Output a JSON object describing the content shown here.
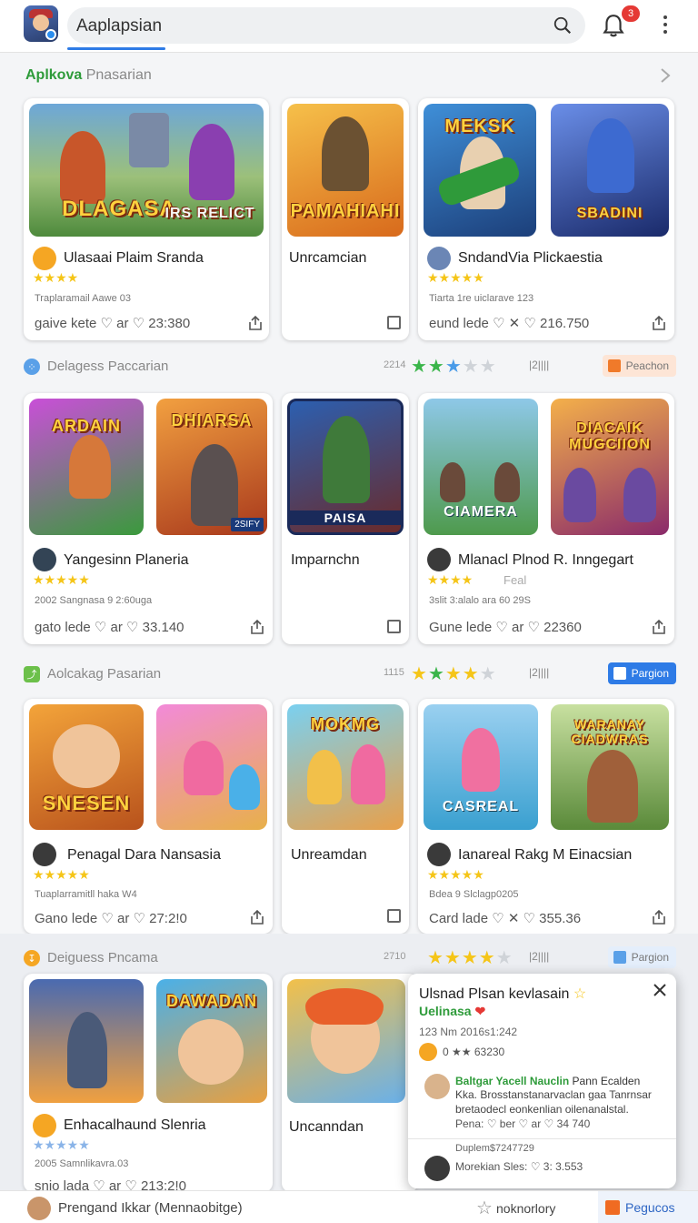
{
  "header": {
    "search_value": "Aaplapsian",
    "notification_count": "3"
  },
  "sections": [
    {
      "title_green": "Aplkova",
      "title_gray": "Pnasarian",
      "cards": [
        {
          "thumb_title": "DLAGASA",
          "thumb_sub": "IRS RELICT",
          "title": "Ulasaai Plaim Sranda",
          "sub": "Traplaramail Aawe 03",
          "footer": "gaive kete  ♡ ar ♡ 23:380",
          "rating": "★★★★"
        },
        {
          "thumb_title": "PAMAHIAHI",
          "title": "Unrcamcian"
        },
        {
          "thumb_title": "MEKSK",
          "title": "SndandVia Plickaestia",
          "sub": "Tiarta 1re uiclarave 123",
          "footer": "eund lede  ♡ ✕ ♡ 216.750",
          "rating": "★★★★★"
        },
        {
          "thumb_title": "SBADINI"
        }
      ]
    },
    {
      "title": "Delagess Paccarian",
      "meta": "2214",
      "bars": "|2||||",
      "button": "Peachon",
      "cards": [
        {
          "thumb_title": "ARDAIN",
          "thumb_title2": "DHIARSA",
          "tag": "2SIFY",
          "title": "Yangesinn Planeria",
          "sub": "2002 Sangnasa 9 2:60uga",
          "footer": "gato lede  ♡ ar ♡ 33.140",
          "rating": "★★★★★"
        },
        {
          "thumb_title": "PAISA",
          "title": "Imparnchn"
        },
        {
          "thumb_title": "CIAMERA",
          "thumb_title2": "DIACAIK MUGCIION",
          "title": "Mlanacl Plnod R. Inngegart",
          "sub": "3slit 3:alalo ara 60 29S",
          "rating_note": "Feal",
          "footer": "Gune lede  ♡ ar ♡ 22360",
          "rating": "★★★★"
        }
      ]
    },
    {
      "title": "Aolcakag Pasarian",
      "meta": "1115",
      "bars": "|2||||",
      "button": "Pargion",
      "cards": [
        {
          "thumb_title": "SNESEN",
          "title": "Penagal Dara Nansasia",
          "sub": "Tuaplarramitll haka W4",
          "footer": "Gano lede  ♡ ar ♡ 27:2!0",
          "rating": "★★★★★"
        },
        {
          "thumb_title": "MOKMG",
          "title": "Unreamdan"
        },
        {
          "thumb_title": "CASREAL",
          "thumb_title2": "WARANAY CIADWRAS",
          "title": "Ianareal Rakg M Einacsian",
          "sub": "Bdea 9 Slclagp0205",
          "footer": "Card lade  ♡ ✕ ♡ 355.36",
          "rating": "★★★★★"
        }
      ]
    },
    {
      "title": "Deiguess Pncama",
      "meta": "2710",
      "bars": "|2||||",
      "button": "Pargion",
      "cards": [
        {
          "thumb_title": "DAWADAN",
          "title": "Enhacalhaund Slenria",
          "sub": "2005 Samnlikavra.03",
          "footer": "snio lada  ♡ ar ♡ 213:2!0",
          "rating": "★★★★★"
        },
        {
          "title": "Uncanndan"
        }
      ]
    }
  ],
  "popup": {
    "title": "Ulsnad Plsan kevlasain",
    "subtitle": "Uelinasa",
    "meta": "123  Nm 2016s1:242",
    "score": "0 ★★  63230",
    "review_name": "Baltgar Yacell Nauclin",
    "review_meta": "Pann Ecalden",
    "review_line1": "Kka. Brosstanstanarvaclan gaa Tanrnsar",
    "review_line2": "bretaodecl eonkenlian oilenanalstal.",
    "review_actions": "Pena:  ♡ ber  ♡ ar  ♡ 34 740",
    "review2_meta": "Duplem$7247729",
    "review2_line": "Morekian Sles:  ♡ 3: 3.553"
  },
  "bottom": {
    "label": "Prengand Ikkar (Mennaobitge)",
    "middle": "noknorlory",
    "button": "Pegucos"
  },
  "colors": {
    "accent_blue": "#2e7be6",
    "accent_green": "#2e9b3a",
    "star_yellow": "#f5c518",
    "badge_red": "#e53935"
  }
}
